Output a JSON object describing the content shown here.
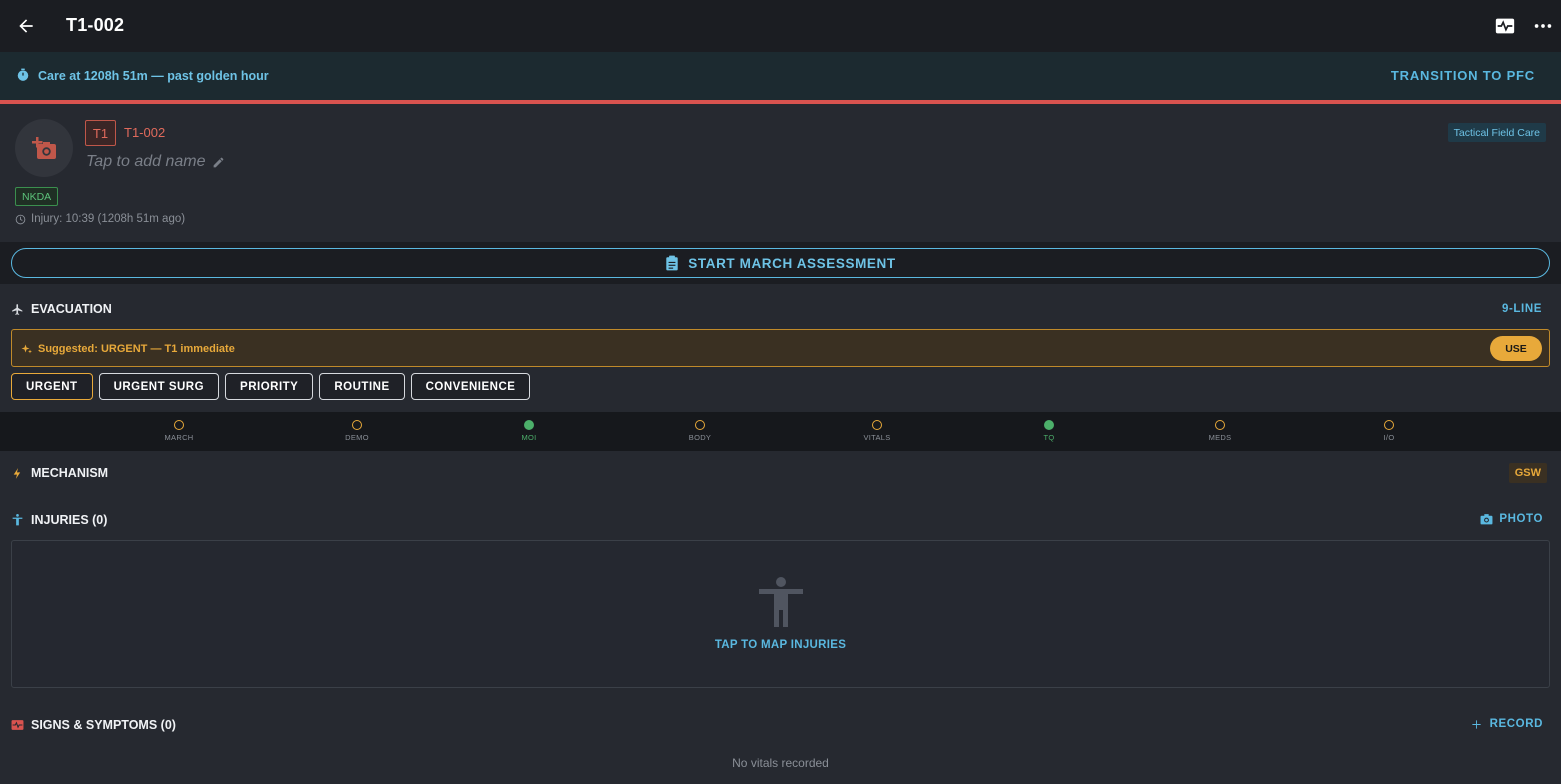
{
  "header": {
    "title": "T1-002",
    "back_icon": "arrow-left-icon",
    "vitals_icon": "monitor-heart-icon",
    "more_icon": "more-vert-icon"
  },
  "care_banner": {
    "text": "Care at 1208h 51m — past golden hour",
    "action": "TRANSITION TO PFC",
    "accent": "#d9534f"
  },
  "patient": {
    "triage": "T1",
    "id": "T1-002",
    "name_placeholder": "Tap to add name",
    "phase": "Tactical Field Care",
    "allergy": "NKDA",
    "injury_time": "Injury: 10:39 (1208h 51m ago)"
  },
  "march_button": "START MARCH ASSESSMENT",
  "evacuation": {
    "title": "EVACUATION",
    "nine_line": "9-LINE",
    "suggestion": "Suggested: URGENT — T1 immediate",
    "use_label": "USE",
    "priorities": [
      "URGENT",
      "URGENT SURG",
      "PRIORITY",
      "ROUTINE",
      "CONVENIENCE"
    ],
    "selected": "URGENT"
  },
  "progress_steps": [
    {
      "label": "MARCH",
      "done": false
    },
    {
      "label": "DEMO",
      "done": false
    },
    {
      "label": "MOI",
      "done": true
    },
    {
      "label": "BODY",
      "done": false
    },
    {
      "label": "VITALS",
      "done": false
    },
    {
      "label": "TQ",
      "done": true
    },
    {
      "label": "MEDS",
      "done": false
    },
    {
      "label": "I/O",
      "done": false
    }
  ],
  "mechanism": {
    "title": "MECHANISM",
    "value": "GSW"
  },
  "injuries": {
    "title": "INJURIES (0)",
    "photo_label": "PHOTO",
    "map_label": "TAP TO MAP INJURIES"
  },
  "signs": {
    "title": "SIGNS & SYMPTOMS (0)",
    "record_label": "RECORD",
    "empty": "No vitals recorded"
  },
  "colors": {
    "accent_blue": "#5ab8e0",
    "warning_orange": "#e8a93a",
    "done_green": "#4caf6a",
    "triage_red": "#e06a5c"
  }
}
